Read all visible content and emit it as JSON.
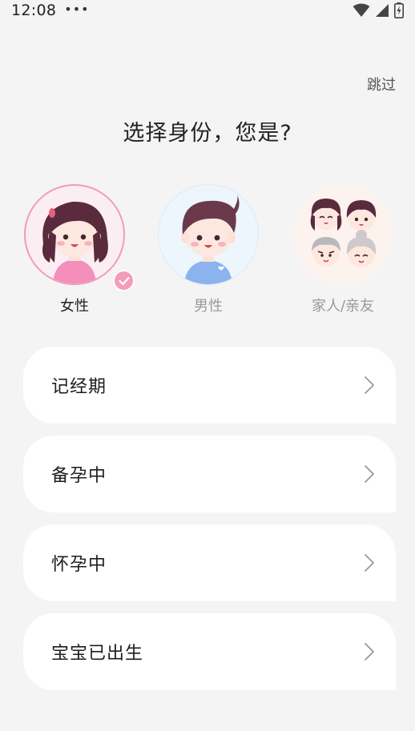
{
  "status_bar": {
    "time": "12:08",
    "more": "•••"
  },
  "header": {
    "skip_label": "跳过",
    "title": "选择身份，您是?"
  },
  "identities": [
    {
      "label": "女性",
      "icon": "female-avatar-icon",
      "selected": true
    },
    {
      "label": "男性",
      "icon": "male-avatar-icon",
      "selected": false
    },
    {
      "label": "家人/亲友",
      "icon": "family-avatar-icon",
      "selected": false
    }
  ],
  "options": [
    {
      "label": "记经期"
    },
    {
      "label": "备孕中"
    },
    {
      "label": "怀孕中"
    },
    {
      "label": "宝宝已出生"
    }
  ],
  "colors": {
    "accent_pink": "#f59bbb",
    "background": "#f4f4f4",
    "card": "#ffffff"
  }
}
